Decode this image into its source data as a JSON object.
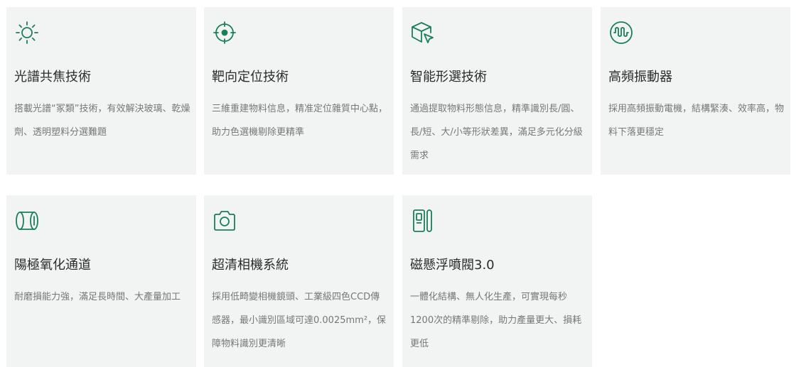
{
  "accent_color": "#1a7f5a",
  "features": [
    {
      "icon": "sun-icon",
      "title": "光譜共焦技術",
      "desc": "搭載光譜“冢類”技術，有效解決玻璃、乾燥劑、透明塑料分選難題"
    },
    {
      "icon": "crosshair-icon",
      "title": "靶向定位技術",
      "desc": "三維重建物料信息，精准定位雜質中心點，助力色選機剔除更精準"
    },
    {
      "icon": "cube-cursor-icon",
      "title": "智能形選技術",
      "desc": "通過提取物料形態信息，精準識別長/圓、長/短、大/小等形狀差異，滿足多元化分級需求"
    },
    {
      "icon": "vibration-icon",
      "title": "高頻振動器",
      "desc": "採用高頻振動電機，結構緊湊、效率高，物料下落更穩定"
    },
    {
      "icon": "cylinder-channel-icon",
      "title": "陽極氧化通道",
      "desc": "耐磨損能力強，滿足長時間、大產量加工"
    },
    {
      "icon": "camera-icon",
      "title": "超清相機系統",
      "desc": "採用低畸變相機鏡頭、工業級四色CCD傳感器，最小識別區域可達0.0025mm²，保障物料識別更清晰"
    },
    {
      "icon": "valve-icon",
      "title": "磁懸浮噴閥3.0",
      "desc": "一體化結構、無人化生產，可實現每秒1200次的精準剔除，助力產量更大、損耗更低"
    }
  ]
}
